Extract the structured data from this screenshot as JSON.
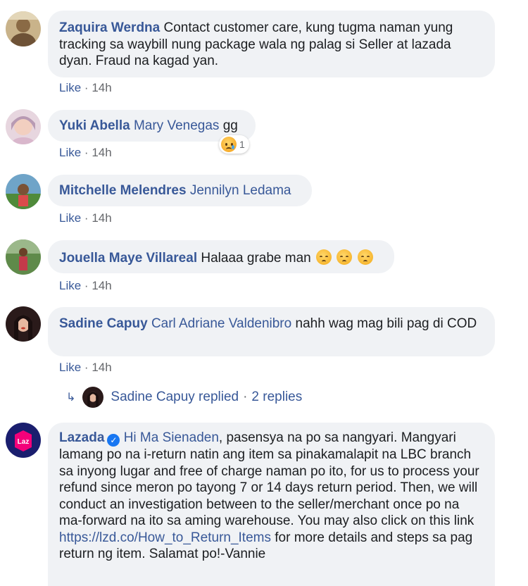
{
  "comments": [
    {
      "author": "Zaquira Werdna",
      "text": " Contact customer care, kung tugma naman yung tracking sa waybill nung package wala ng palag si Seller at lazada dyan. Fraud na kagad yan.",
      "like": "Like",
      "time": "14h"
    },
    {
      "author": "Yuki Abella",
      "mention": "Mary Venegas",
      "text": " gg",
      "like": "Like",
      "time": "14h",
      "reaction": {
        "icon": "sad-reaction-icon",
        "count": "1"
      }
    },
    {
      "author": "Mitchelle Melendres",
      "mention": "Jennilyn Ledama",
      "like": "Like",
      "time": "14h"
    },
    {
      "author": "Jouella Maye Villareal",
      "text": "Halaaa grabe man",
      "like": "Like",
      "time": "14h"
    },
    {
      "author": "Sadine Capuy",
      "mention": "Carl Adriane Valdenibro",
      "text": " nahh wag mag bili pag di COD",
      "like": "Like",
      "time": "14h",
      "replies": {
        "who": "Sadine Capuy replied",
        "sep": "·",
        "count": "2 replies"
      }
    },
    {
      "author": "Lazada",
      "mention": "Hi Ma Sienaden",
      "text": ", pasensya na po sa nangyari. Mangyari lamang po na i-return natin ang item sa pinakamalapit na LBC branch sa inyong lugar and free of charge naman po ito, for us to process your refund since meron po tayong 7 or 14 days return period. Then, we will conduct an investigation between to the seller/merchant once po na ma-forward na ito sa aming warehouse. You may also click on this link ",
      "link": "https://lzd.co/How_to_Return_Items",
      "text2": " for more details and steps sa pag return ng item. Salamat po!-Vannie"
    }
  ],
  "meta_sep": "·",
  "colors": {
    "name": "#385898",
    "bubble": "#f0f2f5",
    "meta": "#65676b",
    "lazada_brand": "#f3007a"
  }
}
